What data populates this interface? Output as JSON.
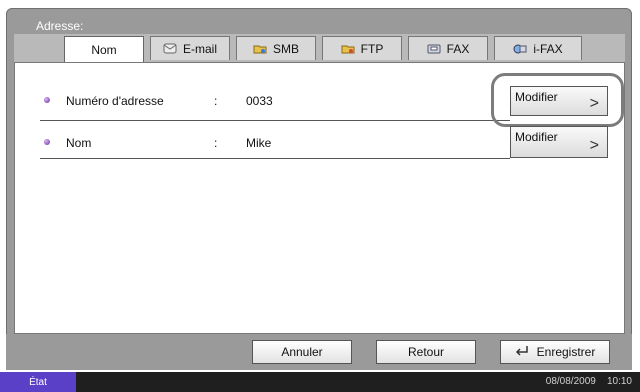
{
  "panel": {
    "title": "Adresse:"
  },
  "tabs": [
    {
      "label": "Nom",
      "icon": "none",
      "active": true
    },
    {
      "label": "E-mail",
      "icon": "email-icon"
    },
    {
      "label": "SMB",
      "icon": "smb-folder-icon"
    },
    {
      "label": "FTP",
      "icon": "ftp-folder-icon"
    },
    {
      "label": "FAX",
      "icon": "fax-icon"
    },
    {
      "label": "i-FAX",
      "icon": "ifax-icon"
    }
  ],
  "fields": [
    {
      "label": "Numéro d'adresse",
      "separator": ":",
      "value": "0033",
      "button": "Modifier"
    },
    {
      "label": "Nom",
      "separator": ":",
      "value": "Mike",
      "button": "Modifier"
    }
  ],
  "actions": {
    "cancel": "Annuler",
    "back": "Retour",
    "save": "Enregistrer"
  },
  "status": {
    "label": "État",
    "date": "08/08/2009",
    "time": "10:10"
  },
  "colors": {
    "accent": "#5a3fc7",
    "bullet": "#6b2aa0"
  }
}
